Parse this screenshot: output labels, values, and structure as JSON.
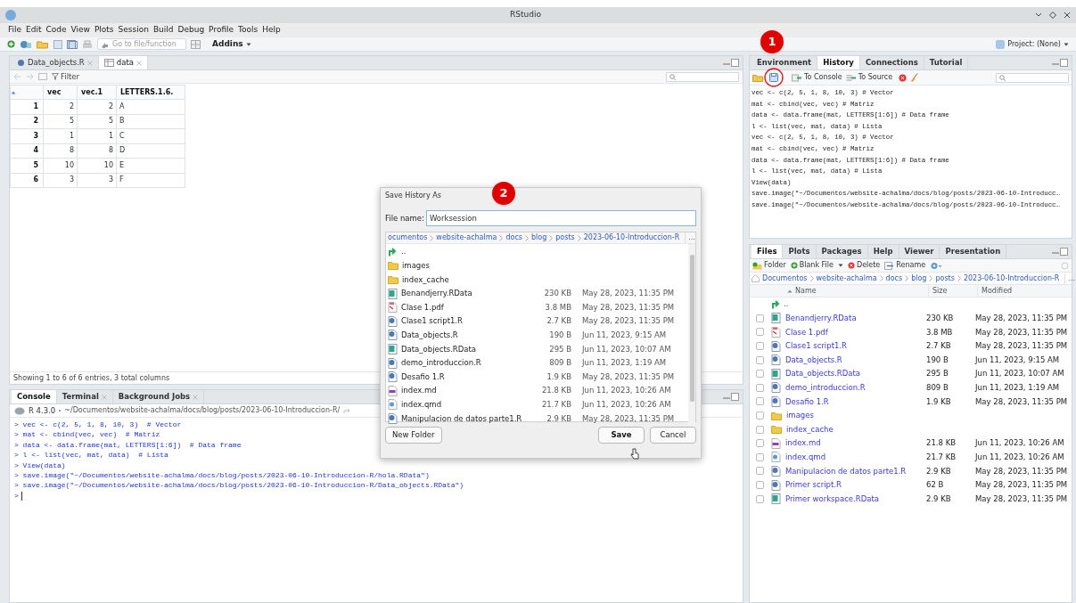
{
  "window": {
    "title": "RStudio"
  },
  "menu": [
    "File",
    "Edit",
    "Code",
    "View",
    "Plots",
    "Session",
    "Build",
    "Debug",
    "Profile",
    "Tools",
    "Help"
  ],
  "toolbar": {
    "goto_placeholder": "Go to file/function",
    "addins": "Addins",
    "project": "Project: (None)"
  },
  "source": {
    "tabs": [
      {
        "label": "Data_objects.R",
        "kind": "script",
        "selected": false
      },
      {
        "label": "data",
        "kind": "table",
        "selected": true
      }
    ],
    "filter": "Filter",
    "columns": [
      "vec",
      "vec.1",
      "LETTERS.1.6."
    ],
    "rows": [
      {
        "index": "1",
        "cells": [
          "2",
          "2",
          "A"
        ]
      },
      {
        "index": "2",
        "cells": [
          "5",
          "5",
          "B"
        ]
      },
      {
        "index": "3",
        "cells": [
          "1",
          "1",
          "C"
        ]
      },
      {
        "index": "4",
        "cells": [
          "8",
          "8",
          "D"
        ]
      },
      {
        "index": "5",
        "cells": [
          "10",
          "10",
          "E"
        ]
      },
      {
        "index": "6",
        "cells": [
          "3",
          "3",
          "F"
        ]
      }
    ],
    "footer": "Showing 1 to 6 of 6 entries, 3 total columns"
  },
  "console": {
    "tabs": [
      {
        "label": "Console",
        "selected": true,
        "closable": false
      },
      {
        "label": "Terminal",
        "selected": false,
        "closable": true
      },
      {
        "label": "Background Jobs",
        "selected": false,
        "closable": true
      }
    ],
    "version": "R 4.3.0",
    "path": "~/Documentos/website-achalma/docs/blog/posts/2023-06-10-Introduccion-R/",
    "lines": [
      "> vec <- c(2, 5, 1, 8, 10, 3)  # Vector",
      "> mat <- cbind(vec, vec)  # Matriz",
      "> data <- data.frame(mat, LETTERS[1:6])  # Data frame",
      "> l <- list(vec, mat, data)  # Lista",
      "> View(data)",
      "> save.image(\"~/Documentos/website-achalma/docs/blog/posts/2023-06-10-Introduccion-R/hola.RData\")",
      "> save.image(\"~/Documentos/website-achalma/docs/blog/posts/2023-06-10-Introduccion-R/Data_objects.RData\")"
    ],
    "prompt": ">"
  },
  "environment": {
    "tabs": [
      {
        "label": "Environment",
        "selected": false
      },
      {
        "label": "History",
        "selected": true
      },
      {
        "label": "Connections",
        "selected": false
      },
      {
        "label": "Tutorial",
        "selected": false
      }
    ],
    "to_console": "To Console",
    "to_source": "To Source",
    "history": [
      "vec <- c(2, 5, 1, 8, 10, 3) # Vector",
      "mat <- cbind(vec, vec) # Matriz",
      "data <- data.frame(mat, LETTERS[1:6]) # Data frame",
      "l <- list(vec, mat, data) # Lista",
      "vec <- c(2, 5, 1, 8, 10, 3) # Vector",
      "mat <- cbind(vec, vec) # Matriz",
      "data <- data.frame(mat, LETTERS[1:6]) # Data frame",
      "l <- list(vec, mat, data) # Lista",
      "View(data)",
      "save.image(\"~/Documentos/website-achalma/docs/blog/posts/2023-06-10-Introducc…",
      "save.image(\"~/Documentos/website-achalma/docs/blog/posts/2023-06-10-Introducc…"
    ]
  },
  "files": {
    "tabs": [
      {
        "label": "Files",
        "selected": true
      },
      {
        "label": "Plots",
        "selected": false
      },
      {
        "label": "Packages",
        "selected": false
      },
      {
        "label": "Help",
        "selected": false
      },
      {
        "label": "Viewer",
        "selected": false
      },
      {
        "label": "Presentation",
        "selected": false
      }
    ],
    "actions": [
      "Folder",
      "Blank File",
      "Delete",
      "Rename"
    ],
    "breadcrumb": [
      "Documentos",
      "website-achalma",
      "docs",
      "blog",
      "posts",
      "2023-06-10-Introduccion-R"
    ],
    "more": "...",
    "columns": [
      "Name",
      "Size",
      "Modified"
    ],
    "up": "..",
    "rows": [
      {
        "kind": "rdata",
        "name": "Benandjerry.RData",
        "size": "230 KB",
        "modified": "May 28, 2023, 11:35 PM",
        "checked": false
      },
      {
        "kind": "pdf",
        "name": "Clase 1.pdf",
        "size": "3.8 MB",
        "modified": "May 28, 2023, 11:35 PM",
        "checked": false
      },
      {
        "kind": "r",
        "name": "Clase1 script1.R",
        "size": "2.7 KB",
        "modified": "May 28, 2023, 11:35 PM",
        "checked": false
      },
      {
        "kind": "r",
        "name": "Data_objects.R",
        "size": "190 B",
        "modified": "Jun 11, 2023, 9:15 AM",
        "checked": false
      },
      {
        "kind": "rdata",
        "name": "Data_objects.RData",
        "size": "295 B",
        "modified": "Jun 11, 2023, 10:07 AM",
        "checked": false
      },
      {
        "kind": "r",
        "name": "demo_introduccion.R",
        "size": "809 B",
        "modified": "Jun 11, 2023, 1:19 AM",
        "checked": false
      },
      {
        "kind": "r",
        "name": "Desafio 1.R",
        "size": "1.9 KB",
        "modified": "May 28, 2023, 11:35 PM",
        "checked": false
      },
      {
        "kind": "folder",
        "name": "images",
        "checked": false
      },
      {
        "kind": "folder",
        "name": "index_cache",
        "checked": false
      },
      {
        "kind": "md",
        "name": "index.md",
        "size": "21.8 KB",
        "modified": "Jun 11, 2023, 10:26 AM",
        "checked": false
      },
      {
        "kind": "qmd",
        "name": "index.qmd",
        "size": "21.7 KB",
        "modified": "Jun 11, 2023, 10:26 AM",
        "checked": false
      },
      {
        "kind": "r",
        "name": "Manipulacion de datos parte1.R",
        "size": "2.9 KB",
        "modified": "May 28, 2023, 11:35 PM",
        "checked": false
      },
      {
        "kind": "r",
        "name": "Primer script.R",
        "size": "62 B",
        "modified": "May 28, 2023, 11:35 PM",
        "checked": false
      },
      {
        "kind": "rdata",
        "name": "Primer workspace.RData",
        "size": "2.9 KB",
        "modified": "May 28, 2023, 11:35 PM",
        "checked": false
      }
    ]
  },
  "dialog": {
    "title": "Save History As",
    "label": "File name:",
    "value": "Worksession",
    "breadcrumb": [
      "ocumentos",
      "website-achalma",
      "docs",
      "blog",
      "posts",
      "2023-06-10-Introduccion-R"
    ],
    "more": "...",
    "up": "..",
    "entries": [
      {
        "kind": "folder",
        "name": "images"
      },
      {
        "kind": "folder",
        "name": "index_cache"
      },
      {
        "kind": "rdata",
        "name": "Benandjerry.RData",
        "size": "230 KB",
        "modified": "May 28, 2023, 11:35 PM"
      },
      {
        "kind": "pdf",
        "name": "Clase 1.pdf",
        "size": "3.8 MB",
        "modified": "May 28, 2023, 11:35 PM"
      },
      {
        "kind": "r",
        "name": "Clase1 script1.R",
        "size": "2.7 KB",
        "modified": "May 28, 2023, 11:35 PM"
      },
      {
        "kind": "r",
        "name": "Data_objects.R",
        "size": "190 B",
        "modified": "Jun 11, 2023, 9:15 AM"
      },
      {
        "kind": "rdata",
        "name": "Data_objects.RData",
        "size": "295 B",
        "modified": "Jun 11, 2023, 10:07 AM"
      },
      {
        "kind": "r",
        "name": "demo_introduccion.R",
        "size": "809 B",
        "modified": "Jun 11, 2023, 1:19 AM"
      },
      {
        "kind": "r",
        "name": "Desafio 1.R",
        "size": "1.9 KB",
        "modified": "May 28, 2023, 11:35 PM"
      },
      {
        "kind": "md",
        "name": "index.md",
        "size": "21.8 KB",
        "modified": "Jun 11, 2023, 10:26 AM"
      },
      {
        "kind": "qmd",
        "name": "index.qmd",
        "size": "21.7 KB",
        "modified": "Jun 11, 2023, 10:26 AM"
      },
      {
        "kind": "r",
        "name": "Manipulacion de datos parte1.R",
        "size": "2.9 KB",
        "modified": "May 28, 2023, 11:35 PM"
      }
    ],
    "buttons": [
      {
        "label": "New Folder",
        "kind": "secondary"
      },
      {
        "label": "Save",
        "kind": "primary"
      },
      {
        "label": "Cancel",
        "kind": "secondary"
      }
    ]
  },
  "callouts": [
    "1",
    "2"
  ]
}
